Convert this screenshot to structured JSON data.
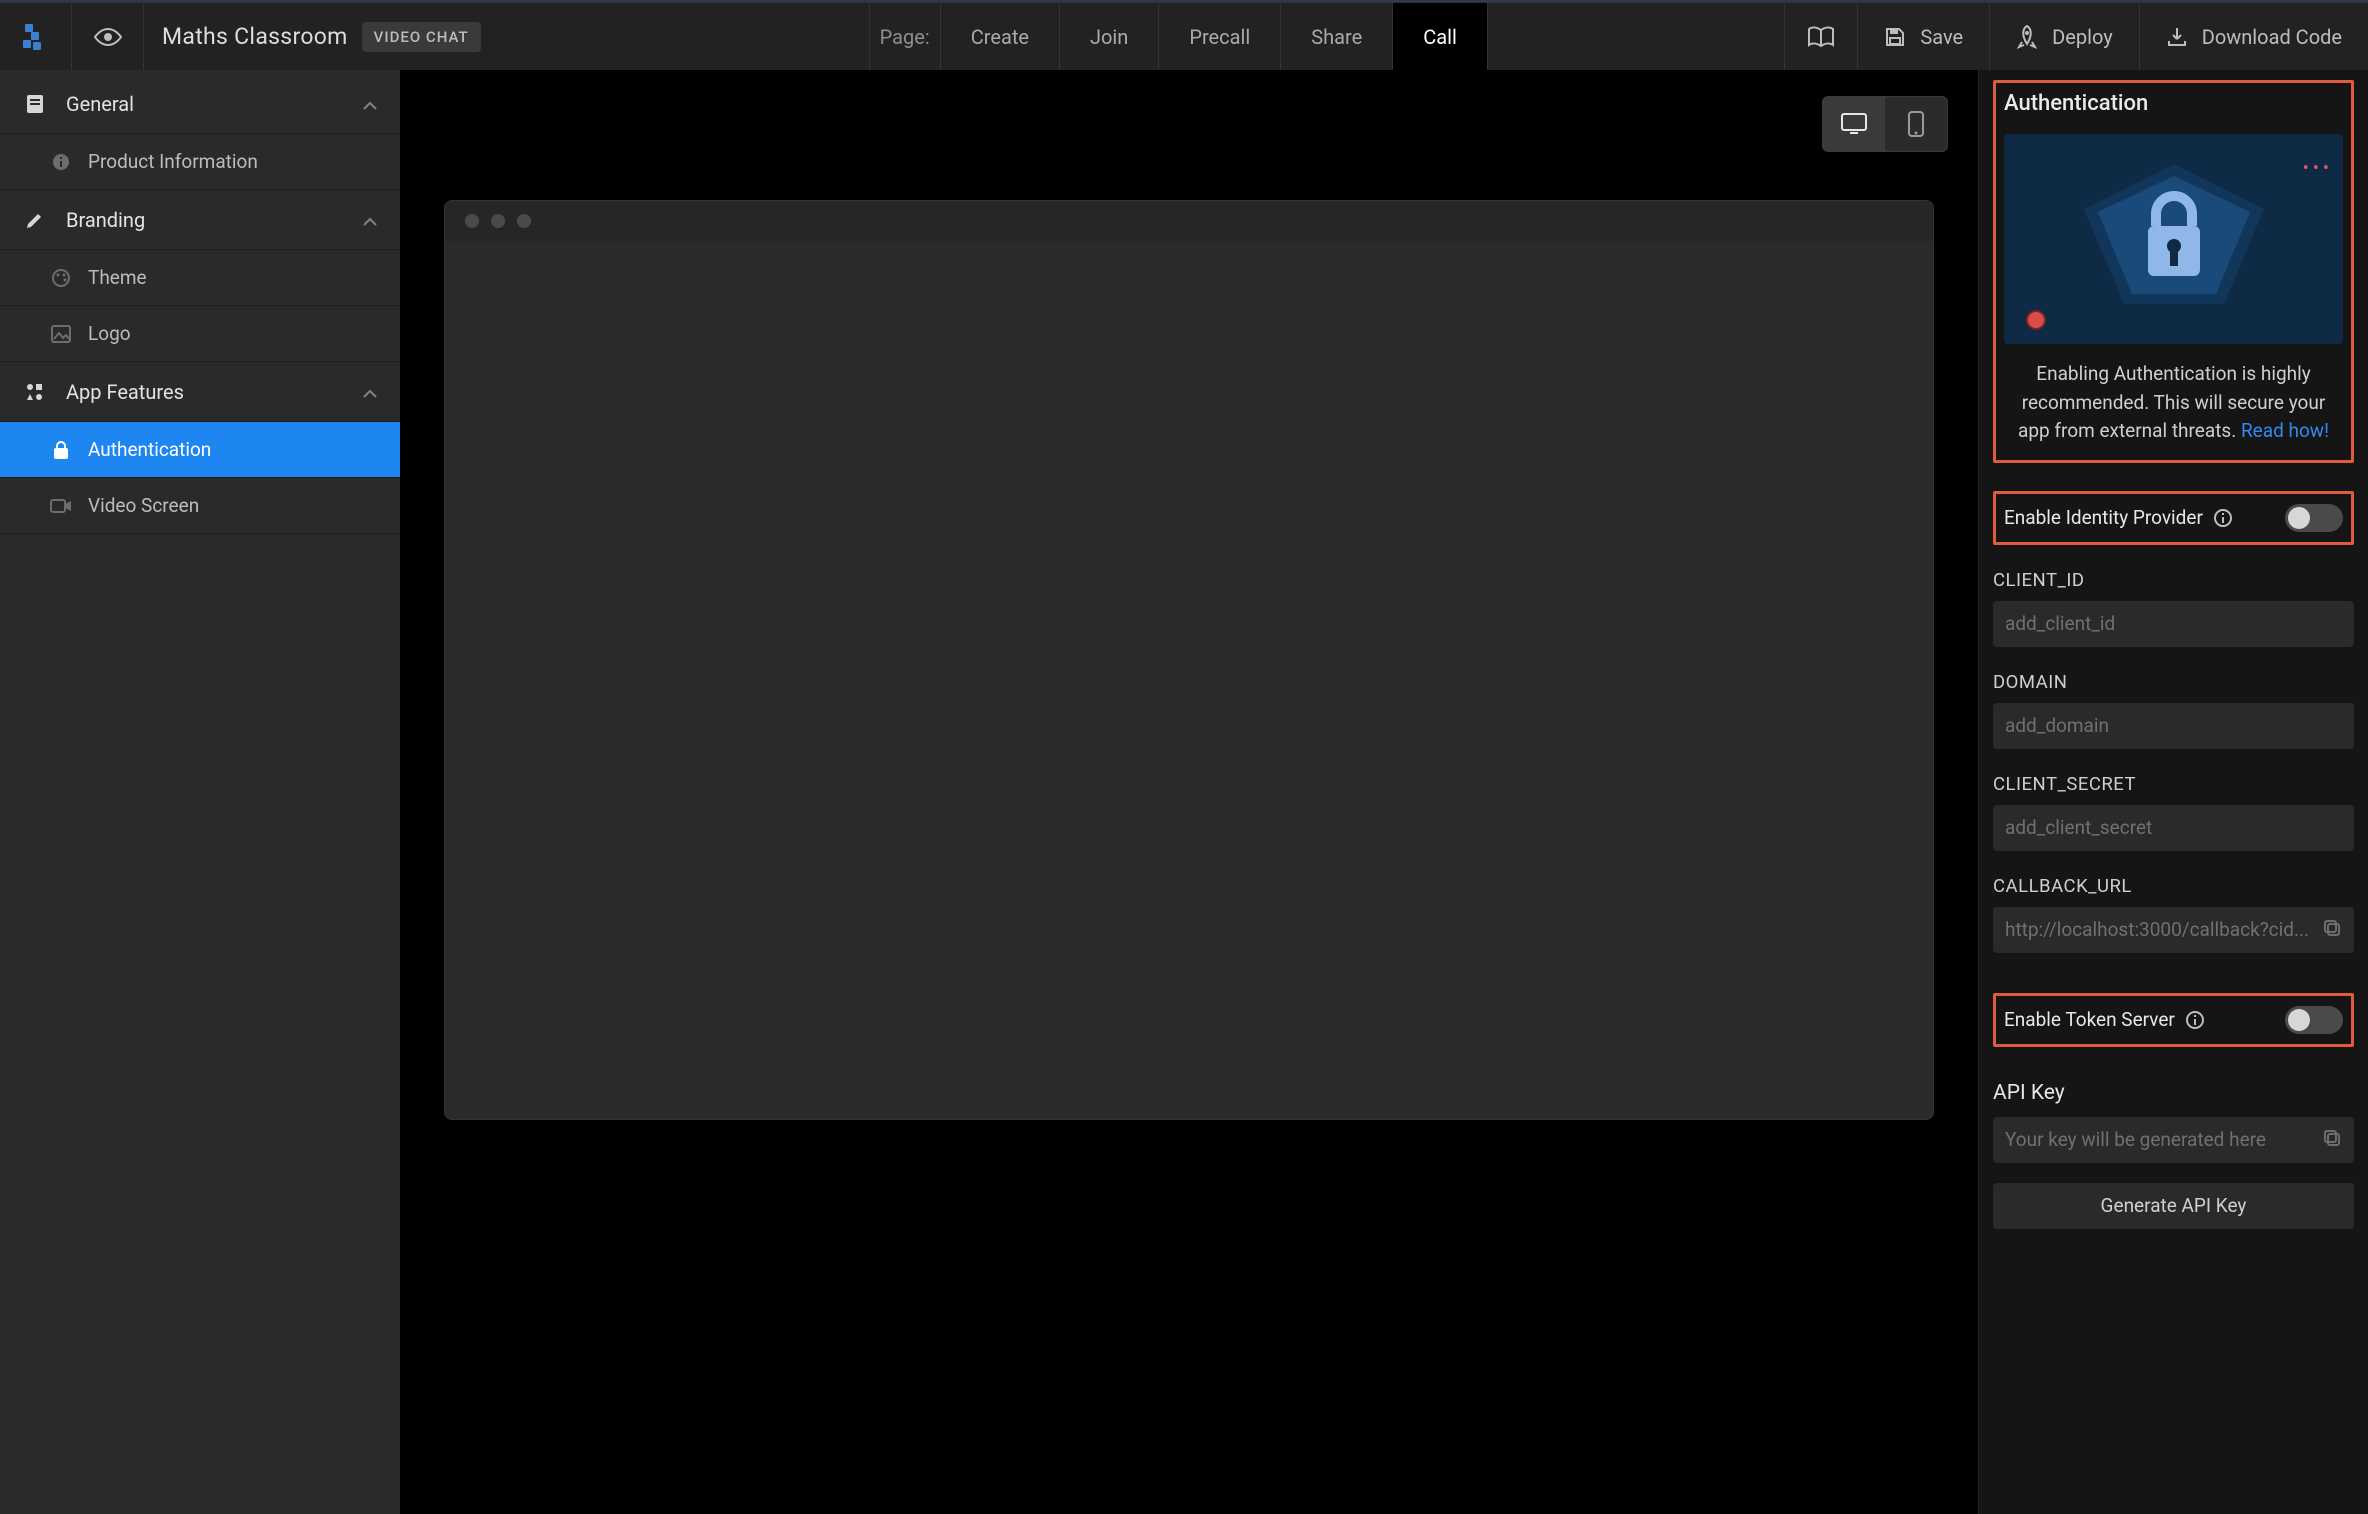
{
  "header": {
    "title": "Maths Classroom",
    "chip": "VIDEO CHAT",
    "pageLabel": "Page:",
    "tabs": [
      {
        "label": "Create"
      },
      {
        "label": "Join"
      },
      {
        "label": "Precall"
      },
      {
        "label": "Share"
      },
      {
        "label": "Call",
        "active": true
      }
    ],
    "actions": {
      "docs": "",
      "save": "Save",
      "deploy": "Deploy",
      "download": "Download Code"
    }
  },
  "sidebar": {
    "sections": [
      {
        "name": "general",
        "label": "General",
        "items": [
          {
            "name": "product-information",
            "label": "Product Information"
          }
        ]
      },
      {
        "name": "branding",
        "label": "Branding",
        "items": [
          {
            "name": "theme",
            "label": "Theme"
          },
          {
            "name": "logo",
            "label": "Logo"
          }
        ]
      },
      {
        "name": "app-features",
        "label": "App Features",
        "items": [
          {
            "name": "authentication",
            "label": "Authentication",
            "active": true
          },
          {
            "name": "video-screen",
            "label": "Video Screen"
          }
        ]
      }
    ]
  },
  "rpanel": {
    "title": "Authentication",
    "heroText1": "Enabling Authentication is highly recommended. This will secure your app from external threats. ",
    "heroLink": "Read how!",
    "idp": {
      "label": "Enable Identity Provider",
      "enabled": false
    },
    "fields": {
      "clientId": {
        "label": "CLIENT_ID",
        "placeholder": "add_client_id",
        "value": ""
      },
      "domain": {
        "label": "DOMAIN",
        "placeholder": "add_domain",
        "value": ""
      },
      "clientSecret": {
        "label": "CLIENT_SECRET",
        "placeholder": "add_client_secret",
        "value": ""
      },
      "callback": {
        "label": "CALLBACK_URL",
        "placeholder": "http://localhost:3000/callback?cid...",
        "value": ""
      }
    },
    "tokenServer": {
      "label": "Enable Token Server",
      "enabled": false
    },
    "apiKey": {
      "label": "API Key",
      "placeholder": "Your key will be generated here",
      "value": "",
      "generate": "Generate API Key"
    }
  }
}
